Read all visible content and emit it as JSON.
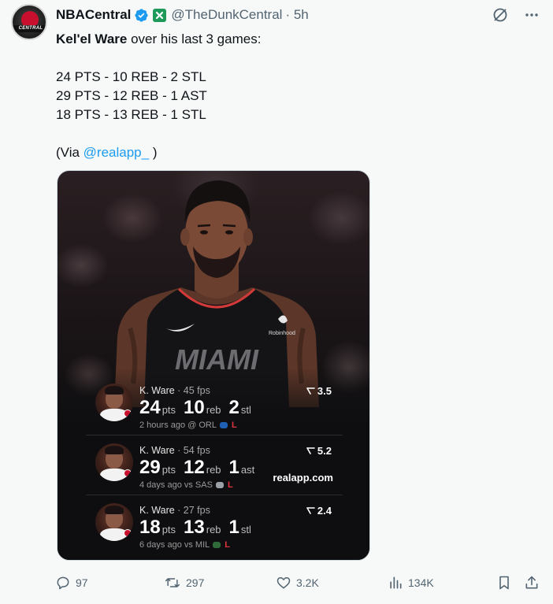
{
  "author": {
    "display_name": "NBACentral",
    "handle": "@TheDunkCentral",
    "time": "· 5h",
    "avatar_text": "CENTRAL"
  },
  "tweet": {
    "line1_bold": "Kel'el Ware",
    "line1_rest": " over his last 3 games:",
    "stat_lines": [
      "24 PTS - 10 REB - 2 STL",
      "29 PTS - 12 REB - 1 AST",
      "18 PTS - 13 REB - 1 STL"
    ],
    "via_prefix": "(Via ",
    "via_link": "@realapp_",
    "via_suffix": " )"
  },
  "media": {
    "jersey_text": "MIAMI",
    "sponsor_text": "Robinhood",
    "brand_watermark": "realapp.com",
    "rows": [
      {
        "player": "K. Ware",
        "fps": " · 45 fps",
        "stat1_num": "24",
        "stat1_unit": "pts",
        "stat2_num": "10",
        "stat2_unit": "reb",
        "stat3_num": "2",
        "stat3_unit": "stl",
        "meta": "2 hours ago @ ORL",
        "result": "L",
        "score": "3.5"
      },
      {
        "player": "K. Ware",
        "fps": " · 54 fps",
        "stat1_num": "29",
        "stat1_unit": "pts",
        "stat2_num": "12",
        "stat2_unit": "reb",
        "stat3_num": "1",
        "stat3_unit": "ast",
        "meta": "4 days ago vs SAS",
        "result": "L",
        "score": "5.2"
      },
      {
        "player": "K. Ware",
        "fps": " · 27 fps",
        "stat1_num": "18",
        "stat1_unit": "pts",
        "stat2_num": "13",
        "stat2_unit": "reb",
        "stat3_num": "1",
        "stat3_unit": "stl",
        "meta": "6 days ago vs MIL",
        "result": "L",
        "score": "2.4"
      }
    ]
  },
  "actions": {
    "replies": "97",
    "reposts": "297",
    "likes": "3.2K",
    "views": "134K"
  },
  "colors": {
    "verified": "#1d9bf0",
    "affiliate": "#1d9a5a",
    "link": "#1d9bf0",
    "loss": "#e1343f",
    "muted": "#536471"
  }
}
